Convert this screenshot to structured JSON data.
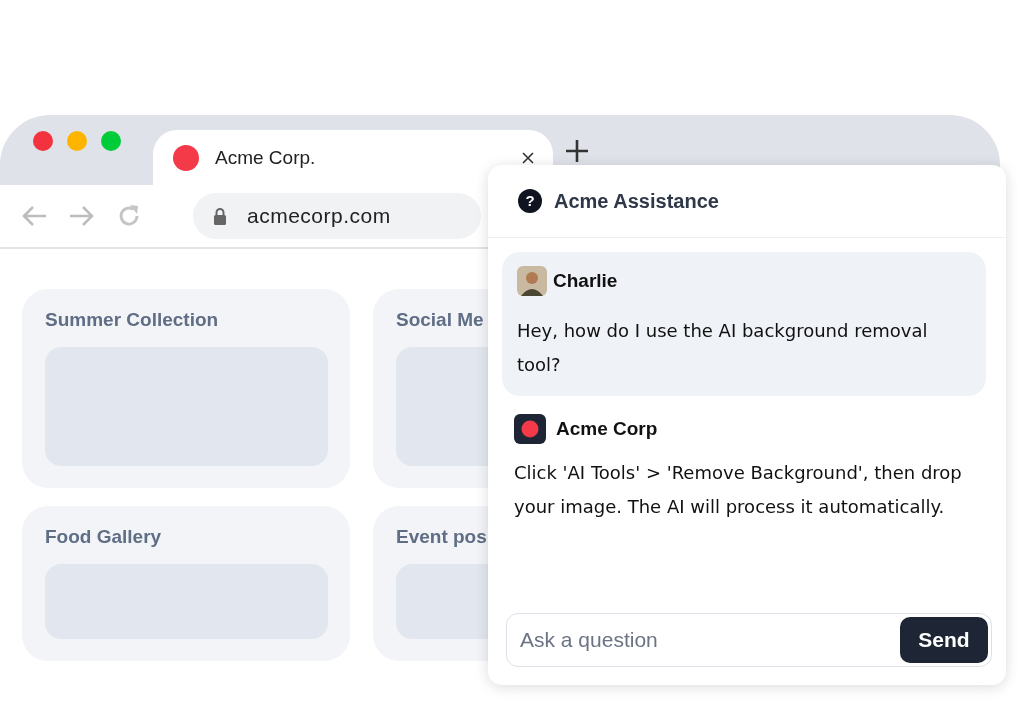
{
  "browser": {
    "tab": {
      "title": "Acme Corp."
    },
    "address": "acmecorp.com"
  },
  "cards": [
    {
      "title": "Summer Collection"
    },
    {
      "title": "Social Me"
    },
    {
      "title": "Food Gallery"
    },
    {
      "title": "Event pos"
    }
  ],
  "chat": {
    "help_glyph": "?",
    "title": "Acme Assistance",
    "messages": [
      {
        "kind": "user",
        "author": "Charlie",
        "text": "Hey, how do I use the AI background removal tool?"
      },
      {
        "kind": "bot",
        "author": "Acme Corp",
        "text": "Click 'AI Tools' > 'Remove Background', then drop your image. The AI will process it automatically."
      }
    ],
    "input": {
      "placeholder": "Ask a question"
    },
    "send": "Send"
  }
}
